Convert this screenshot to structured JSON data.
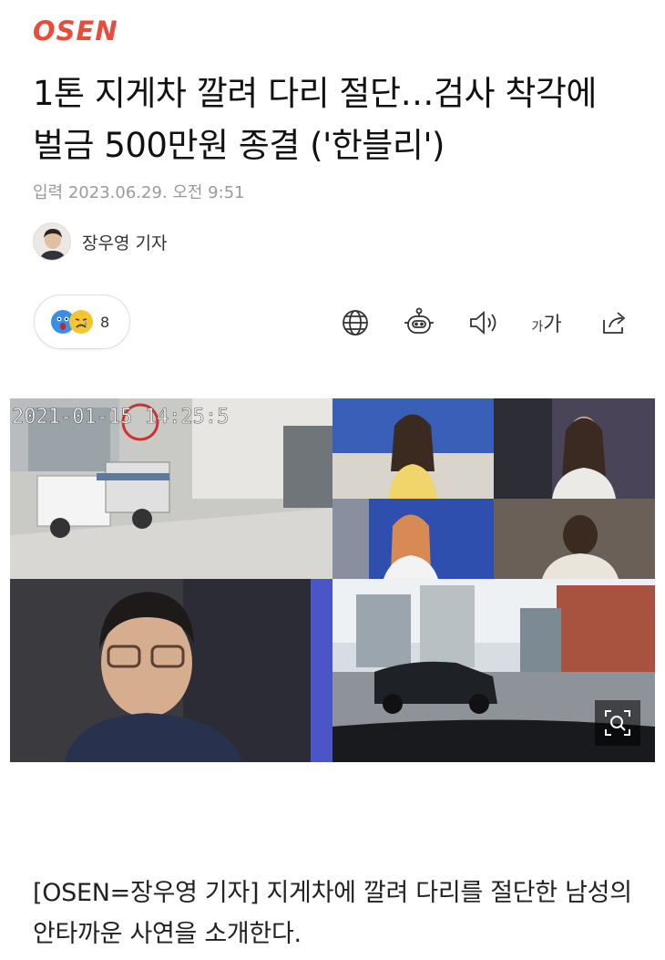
{
  "header": {
    "logo_text": "OSEN",
    "brand_color": "#e84c3d"
  },
  "article": {
    "title": "1톤 지게차 깔려 다리 절단…검사 착각에 벌금 500만원 종결 ('한블리')",
    "date": "입력 2023.06.29. 오전 9:51",
    "author": "장우영 기자",
    "body": "[OSEN=장우영 기자] 지게차에 깔려 다리를 절단한 남성의 안타까운 사연을 소개한다."
  },
  "photo": {
    "cctv_timestamp": "2021-01-15 14:25:5"
  },
  "reactions": {
    "icons": [
      "surprised-face-icon",
      "sad-face-icon"
    ],
    "count": "8"
  },
  "toolbar": {
    "items": [
      "globe-icon",
      "robot-summary-icon",
      "speaker-icon",
      "font-size-icon",
      "share-icon"
    ],
    "font_size_label_small": "가",
    "font_size_label_large": "가"
  }
}
